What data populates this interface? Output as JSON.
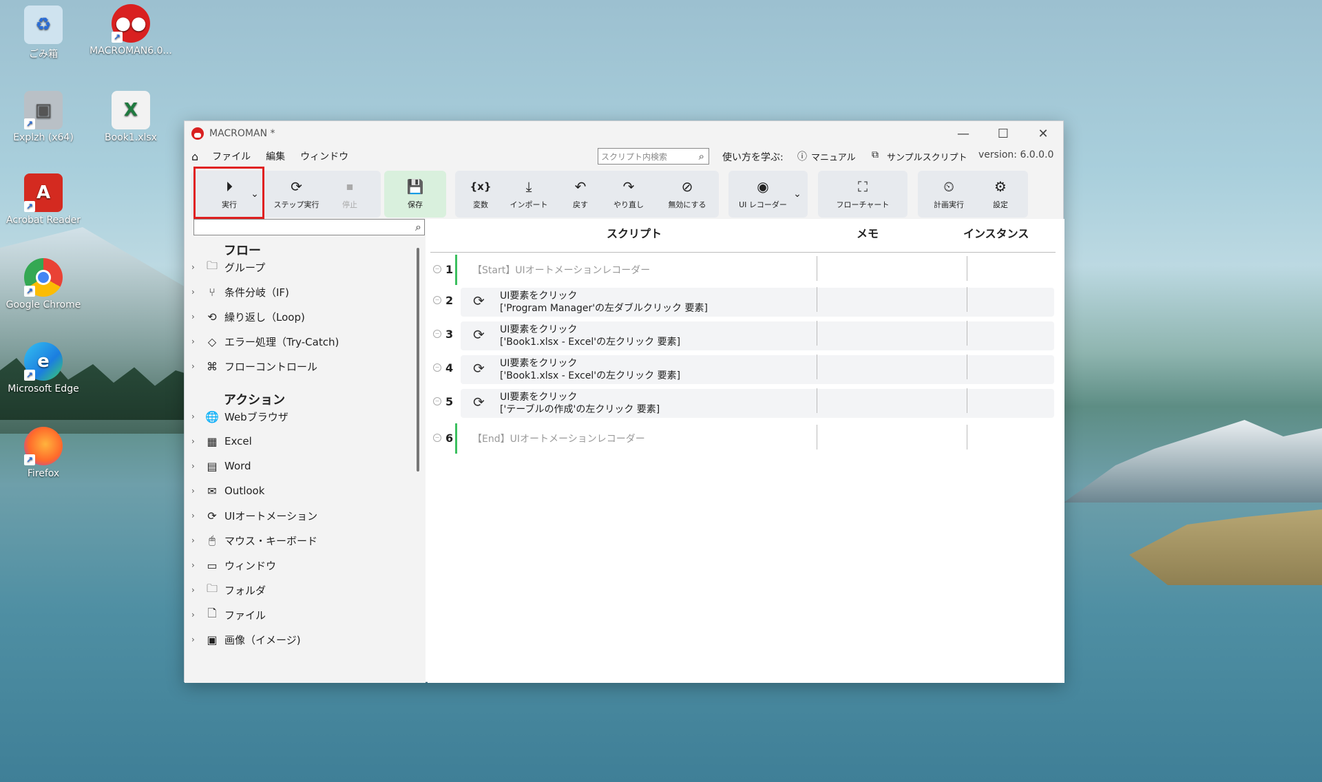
{
  "desktop": {
    "icons": [
      {
        "label": "ごみ箱",
        "icon": "recycle-bin-icon"
      },
      {
        "label": "MACROMAN6.0...",
        "icon": "macroman-icon"
      },
      {
        "label": "Explzh (x64)",
        "icon": "explzh-icon"
      },
      {
        "label": "Book1.xlsx",
        "icon": "excel-file-icon"
      },
      {
        "label": "Acrobat Reader",
        "icon": "acrobat-icon"
      },
      {
        "label": "Google Chrome",
        "icon": "chrome-icon"
      },
      {
        "label": "Microsoft Edge",
        "icon": "edge-icon"
      },
      {
        "label": "Firefox",
        "icon": "firefox-icon"
      }
    ]
  },
  "window": {
    "title": "MACROMAN *",
    "menu": {
      "file": "ファイル",
      "edit": "編集",
      "window": "ウィンドウ"
    },
    "search_placeholder": "スクリプト内検索",
    "learn_label": "使い方を学ぶ:",
    "manual_label": "マニュアル",
    "sample_label": "サンプルスクリプト",
    "version": "version: 6.0.0.0"
  },
  "toolbar": {
    "run": "実行",
    "step_run": "ステップ実行",
    "stop": "停止",
    "save": "保存",
    "variables": "変数",
    "import": "インポート",
    "undo": "戻す",
    "redo": "やり直し",
    "disable": "無効にする",
    "ui_recorder": "UI レコーダー",
    "flowchart": "フローチャート",
    "schedule": "計画実行",
    "settings": "設定",
    "variables_glyph": "{x}"
  },
  "left_panel": {
    "flow_header": "フロー",
    "flow_items": [
      "グループ",
      "条件分岐（IF)",
      "繰り返し（Loop)",
      "エラー処理（Try-Catch)",
      "フローコントロール"
    ],
    "action_header": "アクション",
    "action_items": [
      "Webブラウザ",
      "Excel",
      "Word",
      "Outlook",
      "UIオートメーション",
      "マウス・キーボード",
      "ウィンドウ",
      "フォルダ",
      "ファイル",
      "画像（イメージ)"
    ]
  },
  "main": {
    "columns": {
      "script": "スクリプト",
      "memo": "メモ",
      "instance": "インスタンス"
    },
    "rows": [
      {
        "num": "1",
        "text": "【Start】UIオートメーションレコーダー"
      },
      {
        "num": "2",
        "line1": "UI要素をクリック",
        "line2": "['Program Manager'の左ダブルクリック 要素]"
      },
      {
        "num": "3",
        "line1": "UI要素をクリック",
        "line2": "['Book1.xlsx - Excel'の左クリック 要素]"
      },
      {
        "num": "4",
        "line1": "UI要素をクリック",
        "line2": "['Book1.xlsx - Excel'の左クリック 要素]"
      },
      {
        "num": "5",
        "line1": "UI要素をクリック",
        "line2": "['テーブルの作成'の左クリック 要素]"
      },
      {
        "num": "6",
        "text": "【End】UIオートメーションレコーダー"
      }
    ]
  },
  "colors": {
    "accent_red": "#e02020",
    "active_green": "#3bbf5f",
    "save_bg": "#d9f0dd"
  }
}
